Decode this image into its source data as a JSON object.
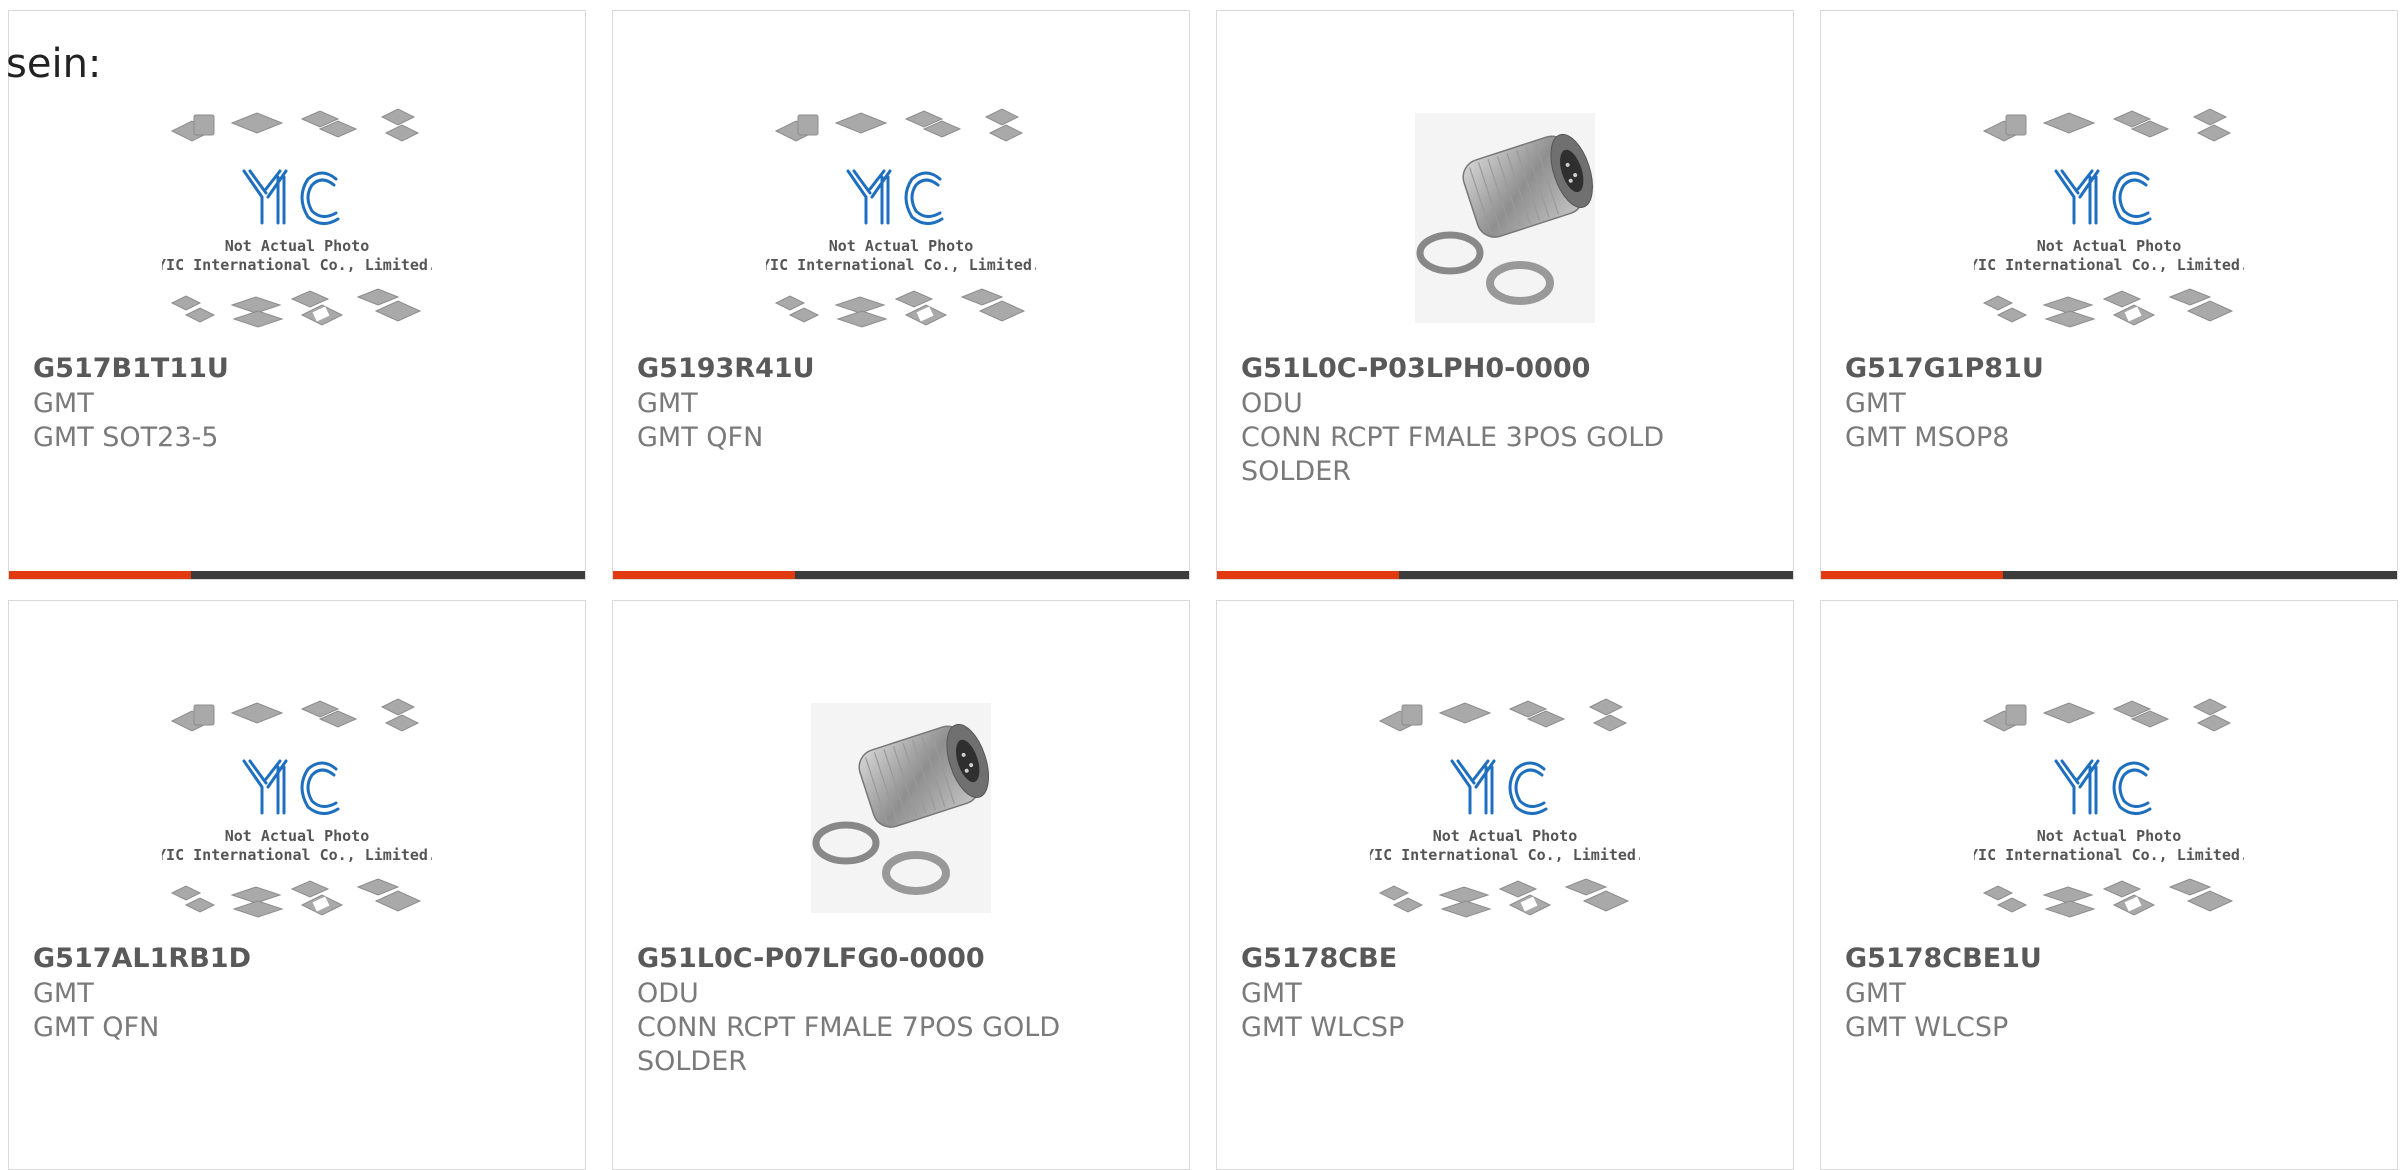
{
  "intro_text": "sein:",
  "placeholder": {
    "line1": "Not Actual Photo",
    "line2": "YIC International Co., Limited."
  },
  "colors": {
    "accent": "#e23a10",
    "bar": "#3c3c3c",
    "logo": "#1f6fbf"
  },
  "cards": [
    {
      "part": "G517B1T11U",
      "manufacturer": "GMT",
      "description": "GMT SOT23-5",
      "image": "placeholder"
    },
    {
      "part": "G5193R41U",
      "manufacturer": "GMT",
      "description": "GMT QFN",
      "image": "placeholder"
    },
    {
      "part": "G51L0C-P03LPH0-0000",
      "manufacturer": "ODU",
      "description": "CONN RCPT FMALE 3POS GOLD SOLDER",
      "image": "connector-photo"
    },
    {
      "part": "G517G1P81U",
      "manufacturer": "GMT",
      "description": "GMT MSOP8",
      "image": "placeholder"
    },
    {
      "part": "G517AL1RB1D",
      "manufacturer": "GMT",
      "description": "GMT QFN",
      "image": "placeholder"
    },
    {
      "part": "G51L0C-P07LFG0-0000",
      "manufacturer": "ODU",
      "description": "CONN RCPT FMALE 7POS GOLD SOLDER",
      "image": "connector-photo"
    },
    {
      "part": "G5178CBE",
      "manufacturer": "GMT",
      "description": "GMT WLCSP",
      "image": "placeholder"
    },
    {
      "part": "G5178CBE1U",
      "manufacturer": "GMT",
      "description": "GMT WLCSP",
      "image": "placeholder"
    }
  ]
}
